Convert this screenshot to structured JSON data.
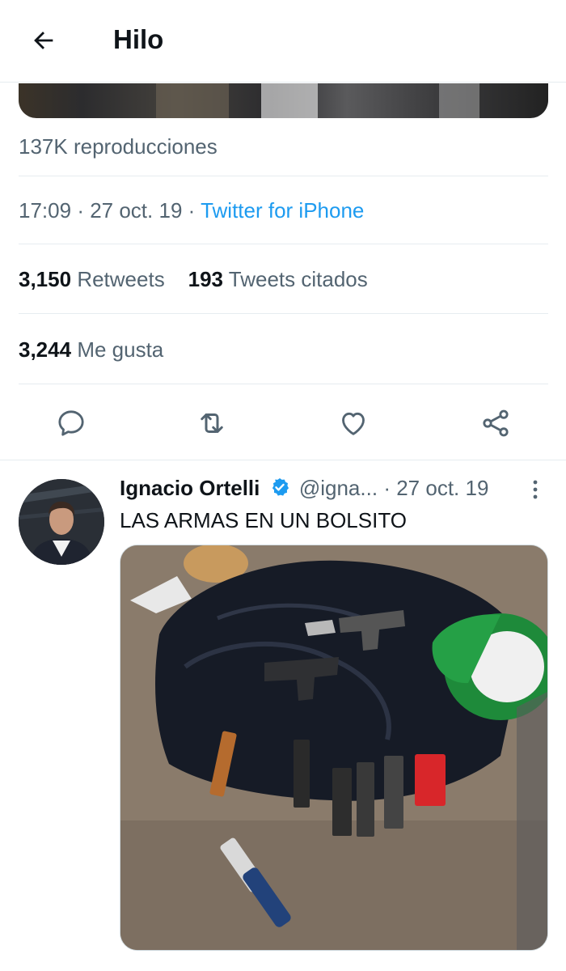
{
  "header": {
    "title": "Hilo",
    "back_icon": "arrow-left-icon"
  },
  "tweet": {
    "views_count": "137K",
    "views_label": "reproducciones",
    "time": "17:09",
    "date": "27 oct. 19",
    "source": "Twitter for iPhone",
    "retweets_count": "3,150",
    "retweets_label": "Retweets",
    "quotes_count": "193",
    "quotes_label": "Tweets citados",
    "likes_count": "3,244",
    "likes_label": "Me gusta"
  },
  "actions": {
    "reply_icon": "reply-icon",
    "retweet_icon": "retweet-icon",
    "like_icon": "heart-icon",
    "share_icon": "share-icon"
  },
  "reply": {
    "author_name": "Ignacio Ortelli",
    "handle": "@igna...",
    "separator": "·",
    "date": "27 oct. 19",
    "text": "LAS ARMAS EN UN BOLSITO"
  },
  "colors": {
    "accent": "#1d9bf0",
    "text_primary": "#0f1419",
    "text_secondary": "#536471",
    "divider": "#e6ecf0"
  }
}
